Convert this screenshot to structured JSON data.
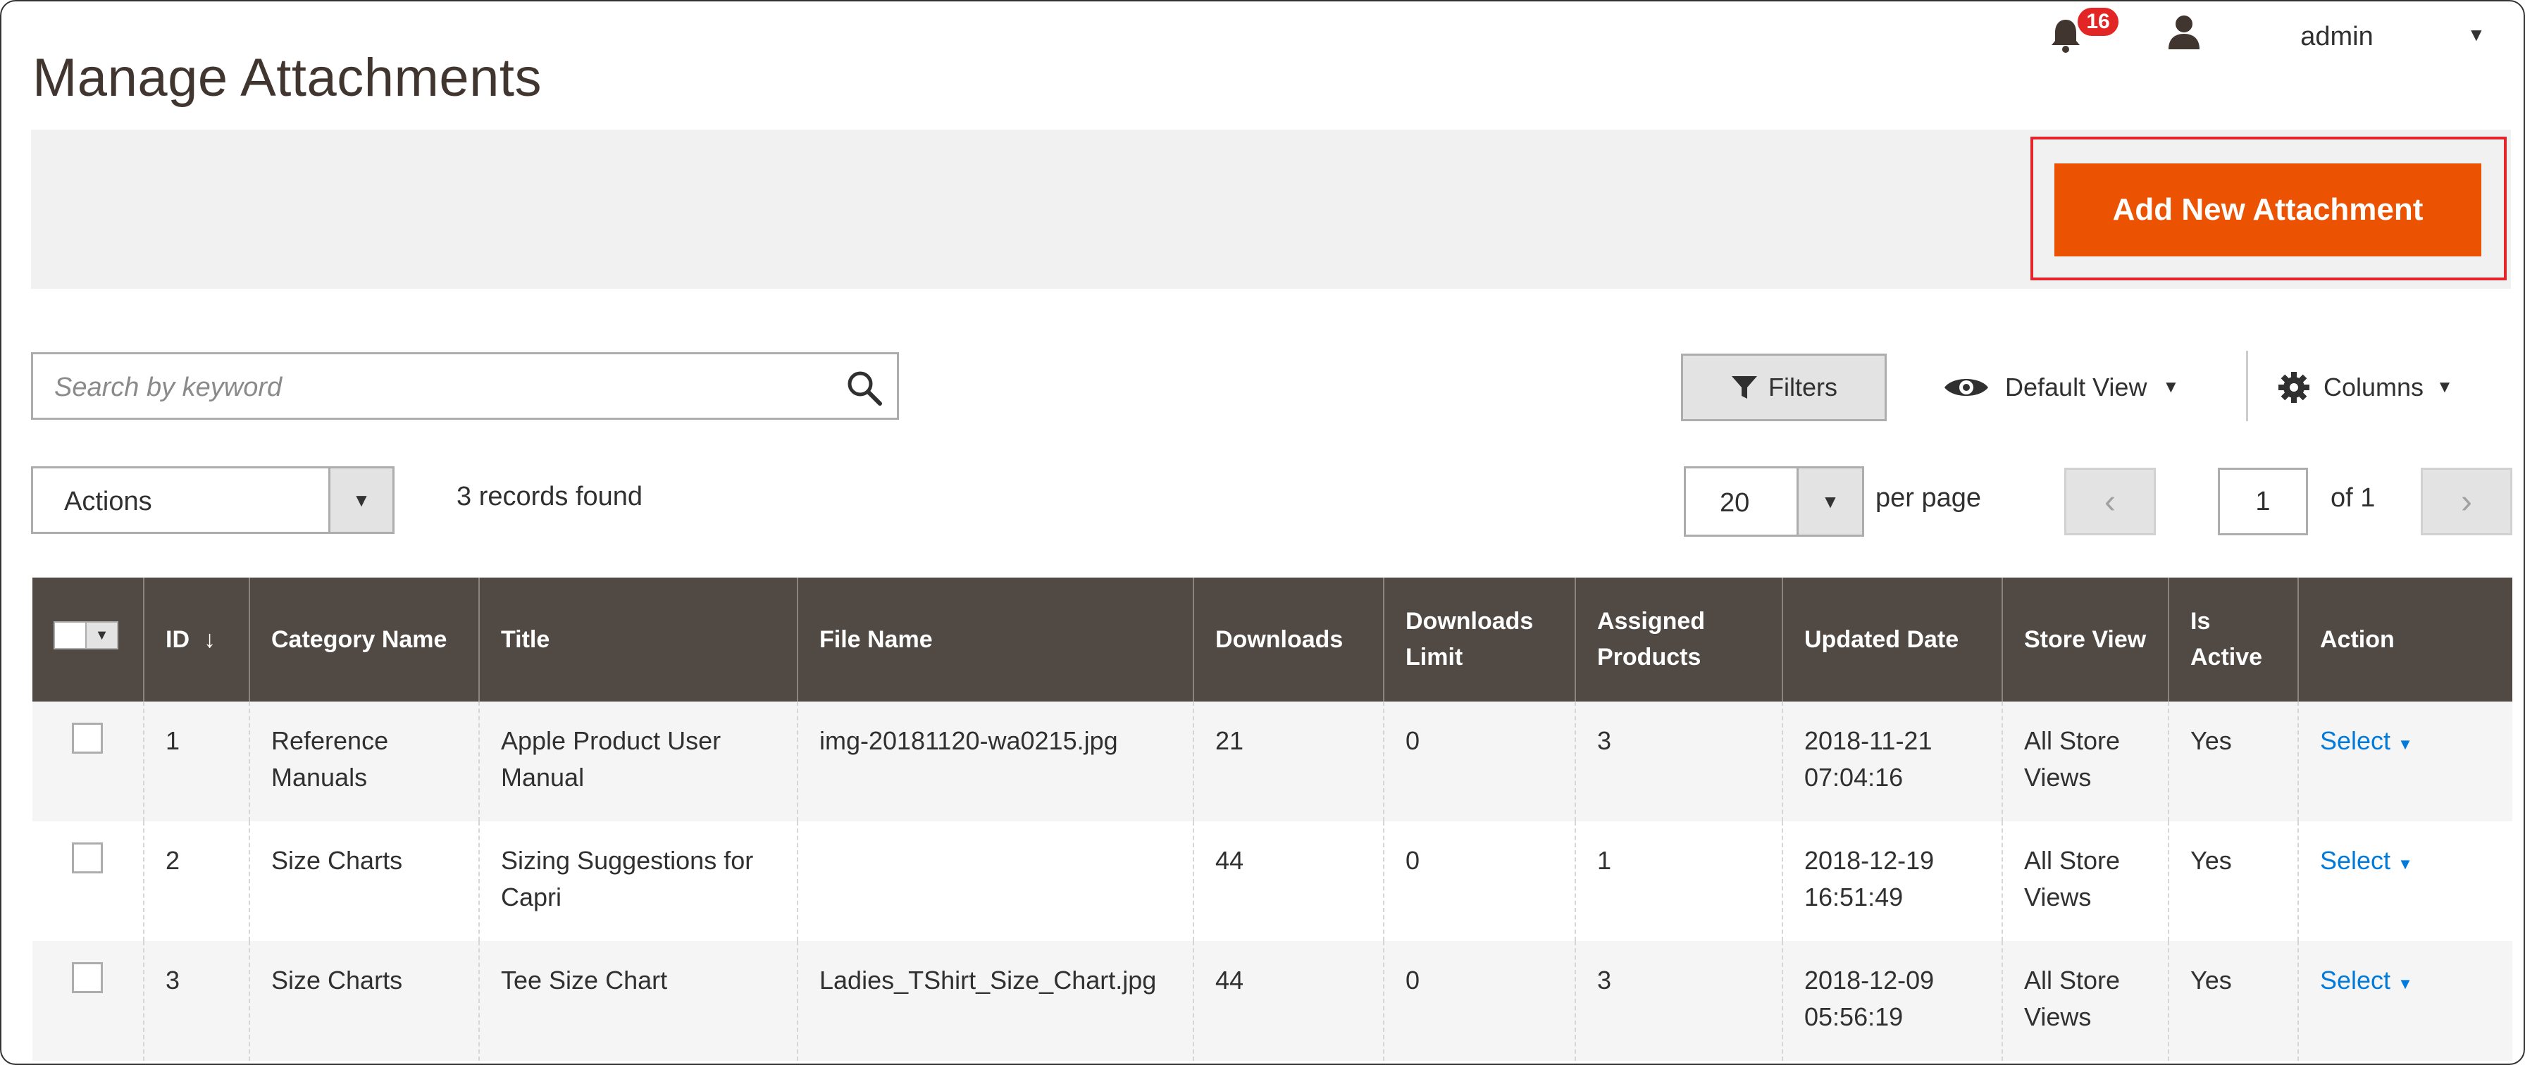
{
  "header": {
    "title": "Manage Attachments",
    "notification_count": "16",
    "user_name": "admin"
  },
  "page_actions": {
    "add_new_label": "Add New Attachment"
  },
  "toolbar": {
    "search_placeholder": "Search by keyword",
    "filters_label": "Filters",
    "default_view_label": "Default View",
    "columns_label": "Columns",
    "actions_label": "Actions",
    "records_found": "3 records found",
    "per_page_value": "20",
    "per_page_label": "per page",
    "current_page": "1",
    "of_pages": "of 1"
  },
  "grid": {
    "columns": [
      "ID",
      "Category Name",
      "Title",
      "File Name",
      "Downloads",
      "Downloads Limit",
      "Assigned Products",
      "Updated Date",
      "Store View",
      "Is Active",
      "Action"
    ],
    "rows": [
      {
        "id": "1",
        "category": "Reference Manuals",
        "title": "Apple Product User Manual",
        "file_name": "img-20181120-wa0215.jpg",
        "downloads": "21",
        "downloads_limit": "0",
        "assigned_products": "3",
        "updated_date": "2018-11-21 07:04:16",
        "store_view": "All Store Views",
        "is_active": "Yes",
        "action": "Select"
      },
      {
        "id": "2",
        "category": "Size Charts",
        "title": "Sizing Suggestions for Capri",
        "file_name": "",
        "downloads": "44",
        "downloads_limit": "0",
        "assigned_products": "1",
        "updated_date": "2018-12-19 16:51:49",
        "store_view": "All Store Views",
        "is_active": "Yes",
        "action": "Select"
      },
      {
        "id": "3",
        "category": "Size Charts",
        "title": "Tee Size Chart",
        "file_name": "Ladies_TShirt_Size_Chart.jpg",
        "downloads": "44",
        "downloads_limit": "0",
        "assigned_products": "3",
        "updated_date": "2018-12-09 05:56:19",
        "store_view": "All Store Views",
        "is_active": "Yes",
        "action": "Select"
      }
    ]
  },
  "colors": {
    "accent_button": "#eb5202",
    "header_bg": "#514943",
    "link": "#007bdb",
    "badge": "#e22626",
    "highlight": "#e3262b"
  }
}
